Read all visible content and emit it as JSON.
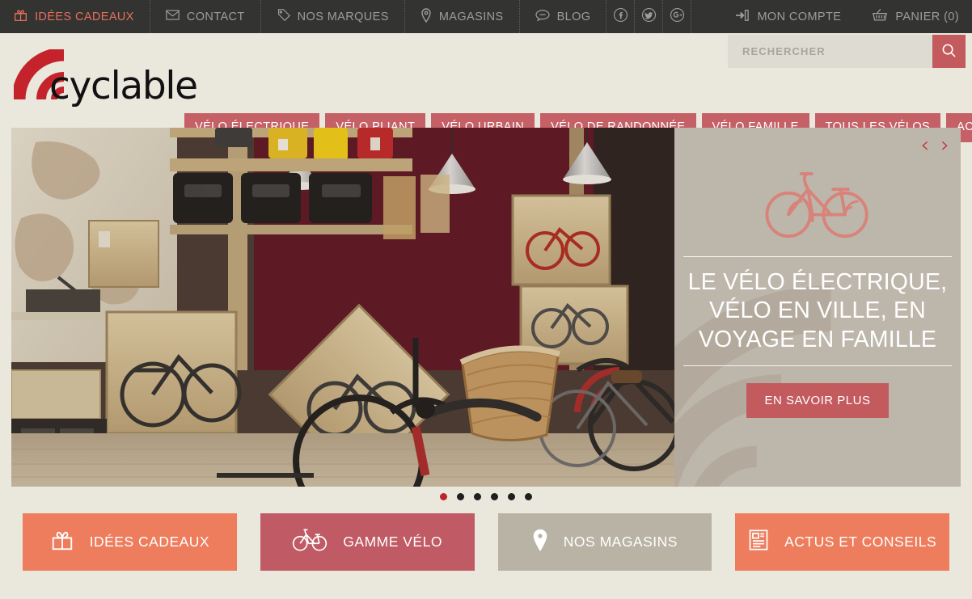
{
  "topbar": {
    "items": [
      {
        "label": "IDÉES CADEAUX",
        "icon": "gift-icon",
        "accent": true
      },
      {
        "label": "CONTACT",
        "icon": "envelope-icon",
        "accent": false
      },
      {
        "label": "NOS MARQUES",
        "icon": "tag-icon",
        "accent": false
      },
      {
        "label": "MAGASINS",
        "icon": "map-pin-icon",
        "accent": false
      },
      {
        "label": "BLOG",
        "icon": "chat-bubble-icon",
        "accent": false
      }
    ],
    "social": [
      "facebook-icon",
      "twitter-icon",
      "google-plus-icon"
    ],
    "account_label": "MON COMPTE",
    "cart_label": "PANIER (0)"
  },
  "brand": {
    "name": "cyclable",
    "logo_color": "#c4232c"
  },
  "search": {
    "placeholder": "RECHERCHER",
    "value": "",
    "icon": "search-icon"
  },
  "nav": {
    "items": [
      "VÉLO ÉLECTRIQUE",
      "VÉLO PLIANT",
      "VÉLO URBAIN",
      "VÉLO DE RANDONNÉE",
      "VÉLO FAMILLE",
      "TOUS LES VÉLOS",
      "ACCESSOIRES ET PIÈCES"
    ],
    "color": "#c66067"
  },
  "hero": {
    "panel": {
      "title": "LE VÉLO ÉLECTRIQUE, VÉLO EN VILLE, EN VOYAGE EN FAMILLE",
      "cta_label": "EN SAVOIR PLUS",
      "prev_icon": "chevron-left-icon",
      "next_icon": "chevron-right-icon",
      "bike_icon": "bicycle-icon",
      "background_color": "#bdb6ab",
      "cta_color": "#c35a5e"
    },
    "carousel": {
      "slide_count": 6,
      "active_index": 0,
      "active_color": "#c0232c"
    }
  },
  "tiles": [
    {
      "label": "IDÉES CADEAUX",
      "icon": "gift-icon",
      "color": "#ed7d5c"
    },
    {
      "label": "GAMME VÉLO",
      "icon": "bicycle-icon",
      "color": "#c05a64"
    },
    {
      "label": "NOS MAGASINS",
      "icon": "map-pin-icon",
      "color": "#b9b3a6"
    },
    {
      "label": "ACTUS ET CONSEILS",
      "icon": "newspaper-icon",
      "color": "#ed7d5c"
    }
  ]
}
